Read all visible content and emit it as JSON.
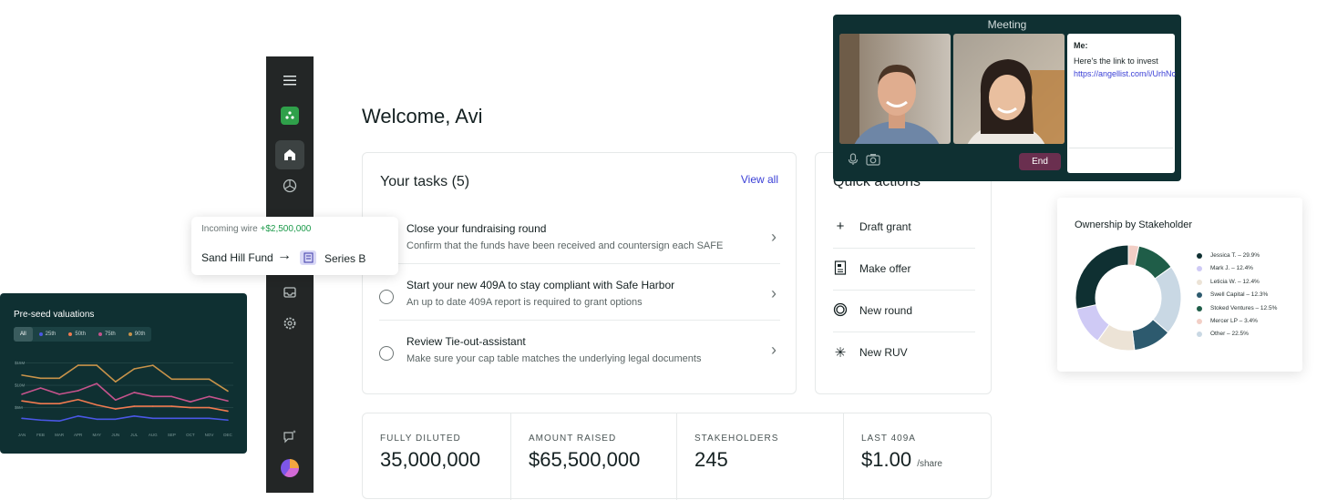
{
  "welcome": "Welcome, Avi",
  "sidebar": {
    "icons": [
      "menu-icon",
      "home-icon",
      "analytics-icon",
      "inbox-icon",
      "settings-icon",
      "assistant-icon"
    ]
  },
  "tasks": {
    "title": "Your tasks (5)",
    "view_all": "View all",
    "items": [
      {
        "title": "Close your fundraising round",
        "subtitle": "Confirm that the funds have been received and countersign each SAFE"
      },
      {
        "title": "Start your new 409A to stay compliant with Safe Harbor",
        "subtitle": "An up to date 409A report is required to grant options"
      },
      {
        "title": "Review Tie-out-assistant",
        "subtitle": "Make sure your cap table matches the underlying legal documents"
      }
    ]
  },
  "quick_actions": {
    "title": "Quick actions",
    "items": [
      {
        "label": "Draft grant",
        "icon": "plus-icon"
      },
      {
        "label": "Make offer",
        "icon": "document-icon"
      },
      {
        "label": "New round",
        "icon": "round-icon"
      },
      {
        "label": "New RUV",
        "icon": "sparkle-icon"
      }
    ]
  },
  "stats": [
    {
      "label": "FULLY DILUTED",
      "value": "35,000,000",
      "unit": ""
    },
    {
      "label": "AMOUNT RAISED",
      "value": "$65,500,000",
      "unit": ""
    },
    {
      "label": "STAKEHOLDERS",
      "value": "245",
      "unit": ""
    },
    {
      "label": "LAST 409A",
      "value": "$1.00",
      "unit": "/share"
    }
  ],
  "wire": {
    "label": "Incoming wire",
    "amount": "+$2,500,000",
    "from": "Sand Hill Fund",
    "to": "Series B"
  },
  "meeting": {
    "title": "Meeting",
    "chat_sender": "Me:",
    "chat_message": "Here's the link to invest",
    "chat_link": "https://angellist.com/i/UrhNc",
    "end_label": "End"
  },
  "ownership": {
    "title": "Ownership by Stakeholder",
    "legend": [
      {
        "label": "Jessica T. – 29.9%",
        "color": "#0f3032"
      },
      {
        "label": "Mark J. – 12.4%",
        "color": "#cfcaf5"
      },
      {
        "label": "Leticia W. – 12.4%",
        "color": "#ece3d6"
      },
      {
        "label": "Swell Capital – 12.3%",
        "color": "#2d5a6e"
      },
      {
        "label": "Stoked Ventures – 12.5%",
        "color": "#1f5d48"
      },
      {
        "label": "Mercer LP – 3.4%",
        "color": "#f2cfc6"
      },
      {
        "label": "Other – 22.5%",
        "color": "#c9d8e4"
      }
    ]
  },
  "preseed": {
    "title": "Pre-seed valuations",
    "tabs": [
      {
        "label": "All",
        "color": ""
      },
      {
        "label": "25th",
        "color": "#4a57e6"
      },
      {
        "label": "50th",
        "color": "#f07a50"
      },
      {
        "label": "75th",
        "color": "#c6538c"
      },
      {
        "label": "90th",
        "color": "#c8934a"
      }
    ]
  },
  "chart_data": {
    "type": "line",
    "title": "Pre-seed valuations",
    "categories": [
      "JAN",
      "FEB",
      "MAR",
      "APR",
      "MAY",
      "JUN",
      "JUL",
      "AUG",
      "SEP",
      "OCT",
      "NOV",
      "DEC"
    ],
    "y_tick_labels": [
      "$15M",
      "$10M",
      "$5M"
    ],
    "ylim": [
      0,
      18
    ],
    "series": [
      {
        "name": "90th",
        "color": "#c8934a",
        "values": [
          12.3,
          11.6,
          11.6,
          14.5,
          14.5,
          10.8,
          13.7,
          14.5,
          11.4,
          11.4,
          11.4,
          8.7
        ]
      },
      {
        "name": "75th",
        "color": "#c6538c",
        "values": [
          8.0,
          9.4,
          8.0,
          8.8,
          10.4,
          6.7,
          8.4,
          7.5,
          7.5,
          6.3,
          7.5,
          6.5
        ]
      },
      {
        "name": "50th",
        "color": "#f07a50",
        "values": [
          6.5,
          5.9,
          5.9,
          6.8,
          5.6,
          4.7,
          5.3,
          5.3,
          5.3,
          5.0,
          5.0,
          4.2
        ]
      },
      {
        "name": "25th",
        "color": "#4a57e6",
        "values": [
          2.6,
          2.2,
          2.0,
          3.1,
          2.4,
          2.4,
          3.1,
          2.6,
          2.6,
          2.6,
          2.6,
          2.2
        ]
      }
    ]
  }
}
